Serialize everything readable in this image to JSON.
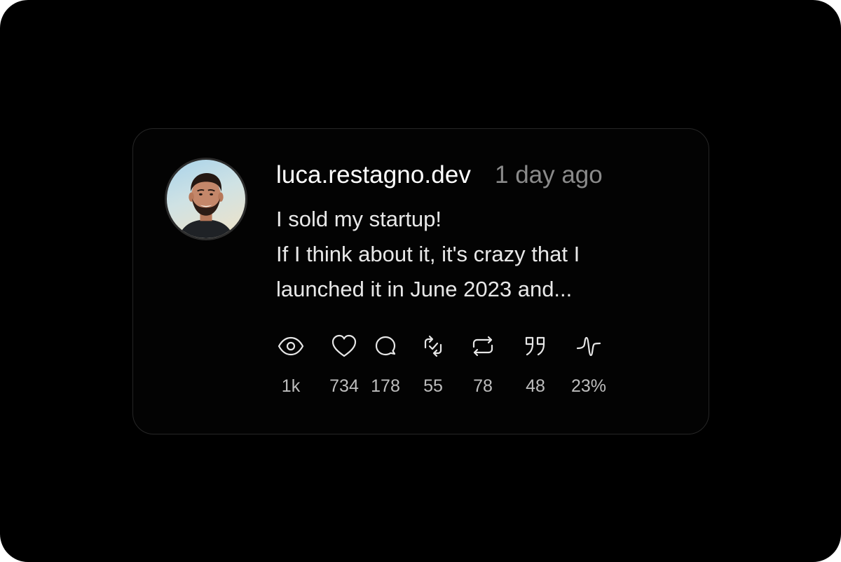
{
  "post": {
    "username": "luca.restagno.dev",
    "time_ago": "1 day ago",
    "body_lines": [
      "I sold my startup!",
      "If I think about it, it's crazy that I",
      "launched it in June 2023 and..."
    ]
  },
  "stats": [
    {
      "icon": "eye-icon",
      "value": "1k"
    },
    {
      "icon": "heart-icon",
      "value": "734"
    },
    {
      "icon": "comment-icon",
      "value": "178"
    },
    {
      "icon": "repost-check-icon",
      "value": "55"
    },
    {
      "icon": "repost-icon",
      "value": "78"
    },
    {
      "icon": "quote-icon",
      "value": "48"
    },
    {
      "icon": "activity-icon",
      "value": "23%"
    }
  ],
  "colors": {
    "background": "#000000",
    "card": "#030303",
    "card_border": "#262626",
    "text_primary": "#ffffff",
    "text_muted": "#8a8a8a",
    "stat_text": "#bdbdbd"
  }
}
